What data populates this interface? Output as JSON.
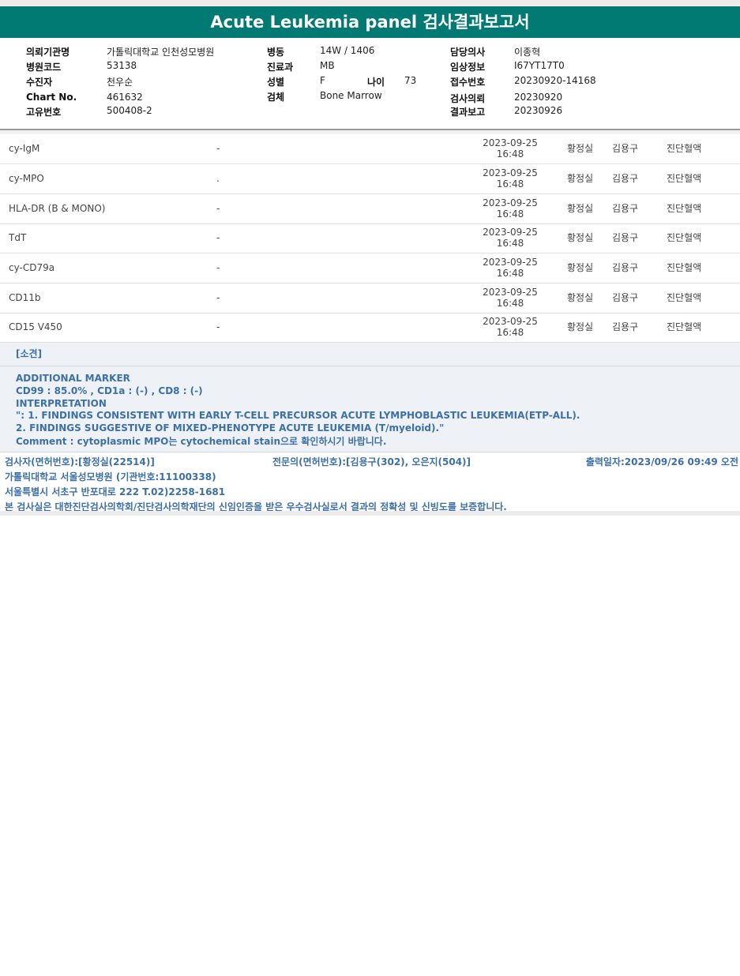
{
  "title": "Acute Leukemia panel 검사결과보고서",
  "header": {
    "col1": [
      {
        "label": "의뢰기관명",
        "value": "가톨릭대학교 인천성모병원"
      },
      {
        "label": "병원코드",
        "value": "53138"
      },
      {
        "label": "수진자",
        "value": "천우순"
      },
      {
        "label": "Chart No.",
        "value": "461632"
      },
      {
        "label": "고유번호",
        "value": "500408-2"
      }
    ],
    "col2": [
      {
        "label": "병동",
        "value": "14W / 1406"
      },
      {
        "label": "진료과",
        "value": "MB"
      },
      {
        "label": "성별",
        "value": "F"
      },
      {
        "label": "검체",
        "value": "Bone Marrow"
      }
    ],
    "age": {
      "label": "나이",
      "value": "73"
    },
    "col3": [
      {
        "label": "담당의사",
        "value": "이종혁"
      },
      {
        "label": "임상정보",
        "value": "I67YT17T0"
      },
      {
        "label": "접수번호",
        "value": "20230920-14168"
      },
      {
        "label": "검사의뢰",
        "value": "20230920"
      },
      {
        "label": "결과보고",
        "value": "20230926"
      }
    ]
  },
  "rows": [
    {
      "name": "cy-IgM",
      "result": "-",
      "date": "2023-09-25",
      "time": "16:48",
      "tech": "황정실",
      "doctor": "김용구",
      "dept": "진단혈액"
    },
    {
      "name": "cy-MPO",
      "result": ".",
      "date": "2023-09-25",
      "time": "16:48",
      "tech": "황정실",
      "doctor": "김용구",
      "dept": "진단혈액"
    },
    {
      "name": "HLA-DR (B & MONO)",
      "result": "-",
      "date": "2023-09-25",
      "time": "16:48",
      "tech": "황정실",
      "doctor": "김용구",
      "dept": "진단혈액"
    },
    {
      "name": "TdT",
      "result": "-",
      "date": "2023-09-25",
      "time": "16:48",
      "tech": "황정실",
      "doctor": "김용구",
      "dept": "진단혈액"
    },
    {
      "name": "cy-CD79a",
      "result": "-",
      "date": "2023-09-25",
      "time": "16:48",
      "tech": "황정실",
      "doctor": "김용구",
      "dept": "진단혈액"
    },
    {
      "name": "CD11b",
      "result": "-",
      "date": "2023-09-25",
      "time": "16:48",
      "tech": "황정실",
      "doctor": "김용구",
      "dept": "진단혈액"
    },
    {
      "name": "CD15 V450",
      "result": "-",
      "date": "2023-09-25",
      "time": "16:48",
      "tech": "황정실",
      "doctor": "김용구",
      "dept": "진단혈액"
    }
  ],
  "opinion": {
    "heading": "[소견]",
    "lines": [
      "ADDITIONAL MARKER",
      "CD99 : 85.0% , CD1a : (-) , CD8 : (-)",
      "INTERPRETATION",
      "\": 1. FINDINGS CONSISTENT WITH EARLY T-CELL PRECURSOR ACUTE LYMPHOBLASTIC LEUKEMIA(ETP-ALL).",
      "2. FINDINGS SUGGESTIVE OF MIXED-PHENOTYPE ACUTE LEUKEMIA (T/myeloid).\"",
      "Comment : cytoplasmic MPO는 cytochemical stain으로 확인하시기 바랍니다."
    ]
  },
  "footer": {
    "tester": "검사자(면허번호):[황정실(22514)]",
    "specialist": "전문의(면허번호):[김용구(302), 오은지(504)]",
    "printed": "출력일자:2023/09/26 09:49 오전",
    "hospital": "가톨릭대학교 서울성모병원 (기관번호:11100338)",
    "address": "서울특별시 서초구 반포대로 222 T.02)2258-1681",
    "certification": "본 검사실은 대한진단검사의학회/진단검사의학재단의 신임인증을 받은 우수검사실로서 결과의 정확성 및 신빙도를 보증합니다."
  }
}
